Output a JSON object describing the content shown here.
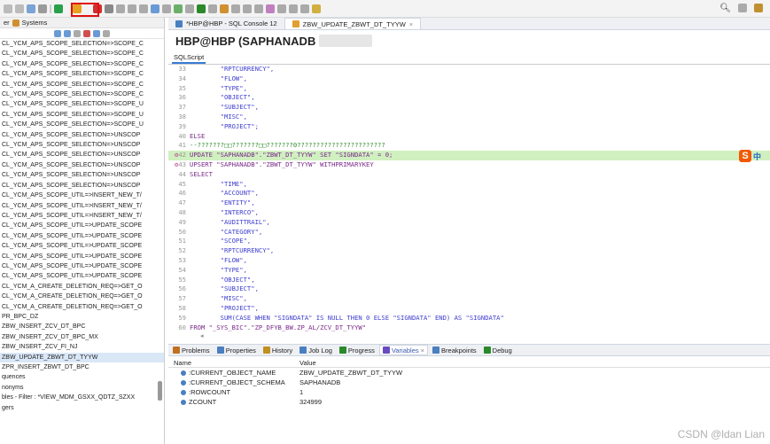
{
  "left_panel": {
    "tab_label": "er",
    "systems_label": "Systems",
    "tree": [
      "CL_YCM_APS_SCOPE_SELECTION=>SCOPE_C",
      "CL_YCM_APS_SCOPE_SELECTION=>SCOPE_C",
      "CL_YCM_APS_SCOPE_SELECTION=>SCOPE_C",
      "CL_YCM_APS_SCOPE_SELECTION=>SCOPE_C",
      "CL_YCM_APS_SCOPE_SELECTION=>SCOPE_C",
      "CL_YCM_APS_SCOPE_SELECTION=>SCOPE_C",
      "CL_YCM_APS_SCOPE_SELECTION=>SCOPE_U",
      "CL_YCM_APS_SCOPE_SELECTION=>SCOPE_U",
      "CL_YCM_APS_SCOPE_SELECTION=>SCOPE_U",
      "CL_YCM_APS_SCOPE_SELECTION=>UNSCOP",
      "CL_YCM_APS_SCOPE_SELECTION=>UNSCOP",
      "CL_YCM_APS_SCOPE_SELECTION=>UNSCOP",
      "CL_YCM_APS_SCOPE_SELECTION=>UNSCOP",
      "CL_YCM_APS_SCOPE_SELECTION=>UNSCOP",
      "CL_YCM_APS_SCOPE_SELECTION=>UNSCOP",
      "CL_YCM_APS_SCOPE_UTIL=>INSERT_NEW_T/",
      "CL_YCM_APS_SCOPE_UTIL=>INSERT_NEW_T/",
      "CL_YCM_APS_SCOPE_UTIL=>INSERT_NEW_T/",
      "CL_YCM_APS_SCOPE_UTIL=>UPDATE_SCOPE",
      "CL_YCM_APS_SCOPE_UTIL=>UPDATE_SCOPE",
      "CL_YCM_APS_SCOPE_UTIL=>UPDATE_SCOPE",
      "CL_YCM_APS_SCOPE_UTIL=>UPDATE_SCOPE",
      "CL_YCM_APS_SCOPE_UTIL=>UPDATE_SCOPE",
      "CL_YCM_APS_SCOPE_UTIL=>UPDATE_SCOPE",
      "CL_YCM_A_CREATE_DELETION_REQ=>GET_O",
      "CL_YCM_A_CREATE_DELETION_REQ=>GET_O",
      "CL_YCM_A_CREATE_DELETION_REQ=>GET_O",
      "PR_BPC_DZ",
      "ZBW_INSERT_ZCV_DT_BPC",
      "ZBW_INSERT_ZCV_DT_BPC_MX",
      "ZBW_INSERT_ZCV_FI_NJ",
      "ZBW_UPDATE_ZBWT_DT_TYYW",
      "ZPR_INSERT_ZBWT_DT_BPC",
      "quences",
      "nonyms",
      "bles - Filter : *VIEW_MDM_GSXX_QDTZ_SZXX",
      "gers"
    ],
    "selected_index": 31
  },
  "tabs": [
    {
      "label": "*HBP@HBP - SQL Console 12",
      "active": false
    },
    {
      "label": "ZBW_UPDATE_ZBWT_DT_TYYW",
      "active": true
    }
  ],
  "header": {
    "title": "HBP@HBP (SAPHANADB"
  },
  "subtab": "SQLScript",
  "code_lines": [
    {
      "n": "33",
      "t": "        \"RPTCURRENCY\",",
      "hl": false,
      "mark": ""
    },
    {
      "n": "34",
      "t": "        \"FLOW\",",
      "hl": false,
      "mark": ""
    },
    {
      "n": "35",
      "t": "        \"TYPE\",",
      "hl": false,
      "mark": ""
    },
    {
      "n": "36",
      "t": "        \"OBJECT\",",
      "hl": false,
      "mark": ""
    },
    {
      "n": "37",
      "t": "        \"SUBJECT\",",
      "hl": false,
      "mark": ""
    },
    {
      "n": "38",
      "t": "        \"MISC\",",
      "hl": false,
      "mark": ""
    },
    {
      "n": "39",
      "t": "        \"PROJECT\";",
      "hl": false,
      "mark": ""
    },
    {
      "n": "40",
      "t": "ELSE",
      "hl": false,
      "mark": ""
    },
    {
      "n": "41",
      "t": "--???????□□???????□□???????0???????????????????????",
      "hl": false,
      "mark": ""
    },
    {
      "n": "42",
      "t": "UPDATE \"SAPHANADB\".\"ZBWT_DT_TYYW\" SET \"SIGNDATA\" = 0;",
      "hl": true,
      "mark": "⚙"
    },
    {
      "n": "43",
      "t": "UPSERT \"SAPHANADB\".\"ZBWT_DT_TYYW\" WITHPRIMARYKEY",
      "hl": false,
      "mark": "⚙"
    },
    {
      "n": "44",
      "t": "SELECT",
      "hl": false,
      "mark": ""
    },
    {
      "n": "45",
      "t": "        \"TIME\",",
      "hl": false,
      "mark": ""
    },
    {
      "n": "46",
      "t": "        \"ACCOUNT\",",
      "hl": false,
      "mark": ""
    },
    {
      "n": "47",
      "t": "        \"ENTITY\",",
      "hl": false,
      "mark": ""
    },
    {
      "n": "48",
      "t": "        \"INTERCO\",",
      "hl": false,
      "mark": ""
    },
    {
      "n": "49",
      "t": "        \"AUDITTRAIL\",",
      "hl": false,
      "mark": ""
    },
    {
      "n": "50",
      "t": "        \"CATEGORY\",",
      "hl": false,
      "mark": ""
    },
    {
      "n": "51",
      "t": "        \"SCOPE\",",
      "hl": false,
      "mark": ""
    },
    {
      "n": "52",
      "t": "        \"RPTCURRENCY\",",
      "hl": false,
      "mark": ""
    },
    {
      "n": "53",
      "t": "        \"FLOW\",",
      "hl": false,
      "mark": ""
    },
    {
      "n": "54",
      "t": "        \"TYPE\",",
      "hl": false,
      "mark": ""
    },
    {
      "n": "55",
      "t": "        \"OBJECT\",",
      "hl": false,
      "mark": ""
    },
    {
      "n": "56",
      "t": "        \"SUBJECT\",",
      "hl": false,
      "mark": ""
    },
    {
      "n": "57",
      "t": "        \"MISC\",",
      "hl": false,
      "mark": ""
    },
    {
      "n": "58",
      "t": "        \"PROJECT\",",
      "hl": false,
      "mark": ""
    },
    {
      "n": "59",
      "t": "        SUM(CASE WHEN \"SIGNDATA\" IS NULL THEN 0 ELSE \"SIGNDATA\" END) AS \"SIGNDATA\"",
      "hl": false,
      "mark": ""
    },
    {
      "n": "60",
      "t": "FROM \"_SYS_BIC\".\"ZP_DFYB_BW.ZP_AL/ZCV_DT_TYYW\"",
      "hl": false,
      "mark": ""
    }
  ],
  "bottom_tabs": [
    {
      "label": "Problems",
      "active": false,
      "color": "#c07020"
    },
    {
      "label": "Properties",
      "active": false,
      "color": "#4a7fc0"
    },
    {
      "label": "History",
      "active": false,
      "color": "#c09020"
    },
    {
      "label": "Job Log",
      "active": false,
      "color": "#4a7fc0"
    },
    {
      "label": "Progress",
      "active": false,
      "color": "#2a8a2a"
    },
    {
      "label": "Variables",
      "active": true,
      "color": "#6a4ac0"
    },
    {
      "label": "Breakpoints",
      "active": false,
      "color": "#4a7fc0"
    },
    {
      "label": "Debug",
      "active": false,
      "color": "#2a8a2a"
    }
  ],
  "variables": {
    "col_name": "Name",
    "col_value": "Value",
    "rows": [
      {
        "name": ":CURRENT_OBJECT_NAME",
        "value": "ZBW_UPDATE_ZBWT_DT_TYYW"
      },
      {
        "name": ":CURRENT_OBJECT_SCHEMA",
        "value": "SAPHANADB"
      },
      {
        "name": ":ROWCOUNT",
        "value": "1"
      },
      {
        "name": "ZCOUNT",
        "value": "324999"
      }
    ]
  },
  "watermark": "CSDN @ldan Lian",
  "ime": {
    "letter": "S",
    "char": "中"
  }
}
